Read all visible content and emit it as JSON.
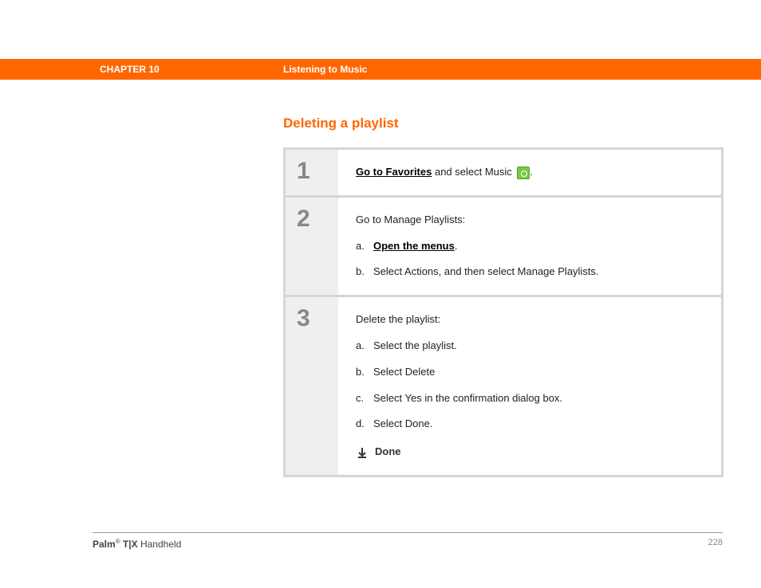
{
  "header": {
    "chapter": "CHAPTER 10",
    "title": "Listening to Music"
  },
  "section_title": "Deleting a playlist",
  "steps": {
    "s1": {
      "num": "1",
      "link": "Go to Favorites",
      "rest": " and select Music "
    },
    "s2": {
      "num": "2",
      "intro": "Go to Manage Playlists:",
      "a_label": "a.",
      "a_link": "Open the menus",
      "a_after": ".",
      "b_label": "b.",
      "b_text": "Select Actions, and then select Manage Playlists."
    },
    "s3": {
      "num": "3",
      "intro": "Delete the playlist:",
      "a_label": "a.",
      "a_text": "Select the playlist.",
      "b_label": "b.",
      "b_text": "Select Delete",
      "c_label": "c.",
      "c_text": "Select Yes in the confirmation dialog box.",
      "d_label": "d.",
      "d_text": "Select Done.",
      "done": "Done"
    }
  },
  "footer": {
    "brand": "Palm",
    "reg": "®",
    "model": " T|X",
    "suffix": " Handheld",
    "page": "228"
  }
}
